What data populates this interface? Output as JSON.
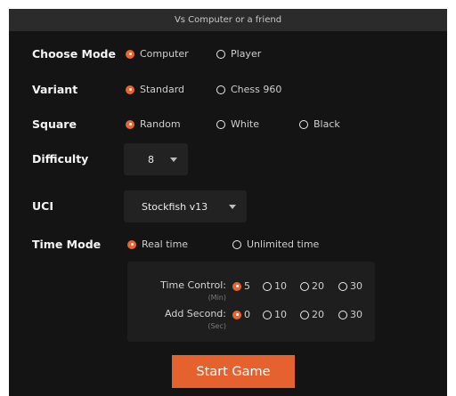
{
  "header": {
    "title": "Vs Computer or a friend"
  },
  "mode": {
    "label": "Choose Mode",
    "options": [
      "Computer",
      "Player"
    ],
    "selected": "Computer"
  },
  "variant": {
    "label": "Variant",
    "options": [
      "Standard",
      "Chess 960"
    ],
    "selected": "Standard"
  },
  "square": {
    "label": "Square",
    "options": [
      "Random",
      "White",
      "Black"
    ],
    "selected": "Random"
  },
  "difficulty": {
    "label": "Difficulty",
    "value": "8"
  },
  "uci": {
    "label": "UCI",
    "value": "Stockfish v13"
  },
  "time_mode": {
    "label": "Time Mode",
    "options": [
      "Real time",
      "Unlimited time"
    ],
    "selected": "Real time"
  },
  "time_control": {
    "label": "Time Control:",
    "unit": "(Min)",
    "options": [
      "5",
      "10",
      "20",
      "30"
    ],
    "selected": "5"
  },
  "add_second": {
    "label": "Add Second:",
    "unit": "(Sec)",
    "options": [
      "0",
      "10",
      "20",
      "30"
    ],
    "selected": "0"
  },
  "start_button": {
    "label": "Start Game"
  },
  "colors": {
    "accent": "#e8652f",
    "background": "#141414",
    "header": "#2b2b2b"
  }
}
